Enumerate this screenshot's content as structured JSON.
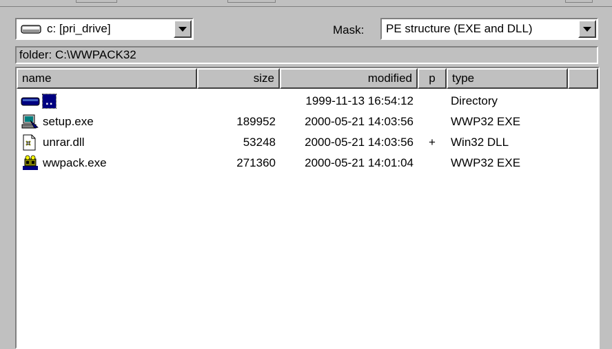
{
  "drive": {
    "value": "c: [pri_drive]",
    "icon": "drive-icon"
  },
  "mask": {
    "label": "Mask:",
    "value": "PE structure (EXE and DLL)"
  },
  "folder": {
    "text": "folder: C:\\WWPACK32"
  },
  "columns": {
    "name": "name",
    "size": "size",
    "modified": "modified",
    "p": "p",
    "type": "type"
  },
  "files": [
    {
      "name": "..",
      "size": "",
      "modified": "1999-11-13 16:54:12",
      "p": "",
      "type": "Directory",
      "icon": "parent-folder-icon"
    },
    {
      "name": "setup.exe",
      "size": "189952",
      "modified": "2000-05-21 14:03:56",
      "p": "",
      "type": "WWP32 EXE",
      "icon": "setup-exe-icon"
    },
    {
      "name": "unrar.dll",
      "size": "53248",
      "modified": "2000-05-21 14:03:56",
      "p": "+",
      "type": "Win32 DLL",
      "icon": "dll-file-icon"
    },
    {
      "name": "wwpack.exe",
      "size": "271360",
      "modified": "2000-05-21 14:01:04",
      "p": "",
      "type": "WWP32 EXE",
      "icon": "wwpack-exe-icon"
    }
  ],
  "colors": {
    "face": "#c0c0c0",
    "shadow": "#808080",
    "highlight": "#ffffff",
    "selection": "#000080",
    "list_bg": "#ffffff"
  }
}
